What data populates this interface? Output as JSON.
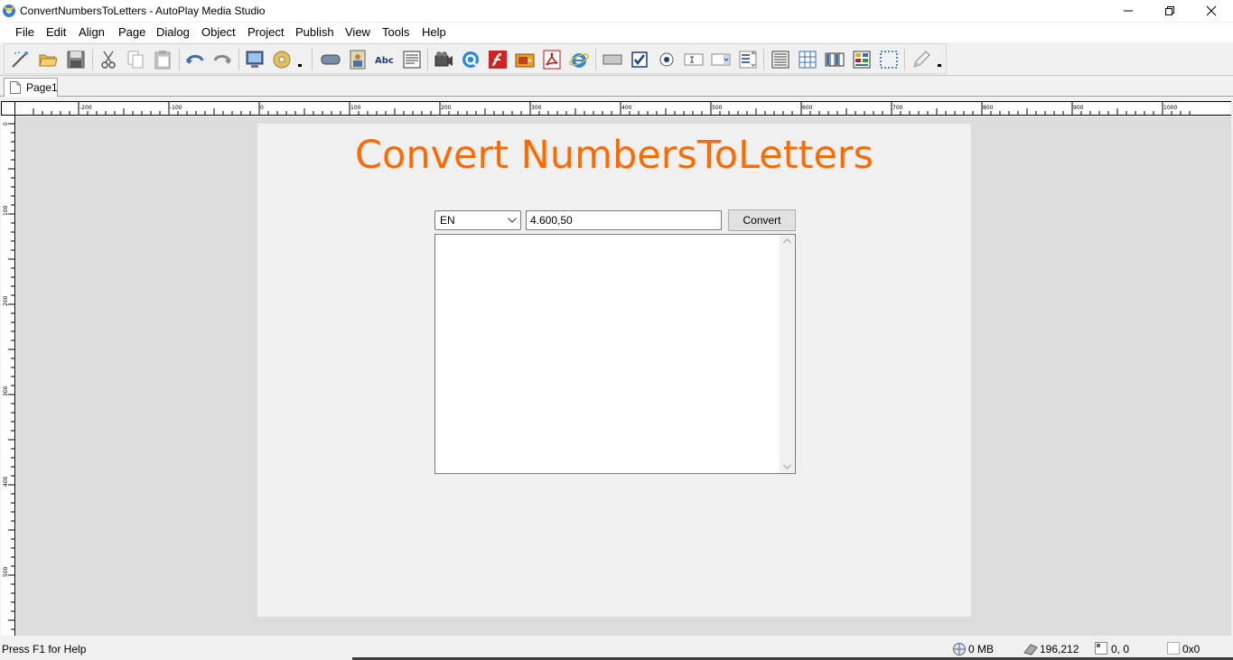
{
  "window": {
    "title": "ConvertNumbersToLetters - AutoPlay Media Studio"
  },
  "menu": {
    "items": [
      "File",
      "Edit",
      "Align",
      "Page",
      "Dialog",
      "Object",
      "Project",
      "Publish",
      "View",
      "Tools",
      "Help"
    ]
  },
  "toolbar": {
    "icons": [
      "new-project-wizard-icon",
      "open-icon",
      "save-icon",
      "cut-icon",
      "copy-icon",
      "paste-icon",
      "undo-icon",
      "redo-icon",
      "preview-icon",
      "publish-cd-icon",
      "button-object-icon",
      "image-object-icon",
      "label-object-icon",
      "paragraph-object-icon",
      "video-object-icon",
      "quicktime-object-icon",
      "flash-object-icon",
      "slideshow-object-icon",
      "pdf-object-icon",
      "web-object-icon",
      "input-object-icon",
      "checkbox-object-icon",
      "radiobutton-object-icon",
      "input-field-object-icon",
      "combobox-object-icon",
      "listbox-object-icon",
      "grid-object-icon",
      "table-grid-object-icon",
      "tree-object-icon",
      "progress-object-icon",
      "selection-object-icon",
      "plugin-object-icon"
    ]
  },
  "tabs": {
    "page1": "Page1"
  },
  "ruler": {
    "horizontal": [
      "-200",
      "-100",
      "0",
      "100",
      "200",
      "300",
      "400",
      "500",
      "600",
      "700",
      "800",
      "900",
      "1000"
    ],
    "vertical": [
      "0",
      "100",
      "200",
      "300",
      "400",
      "500"
    ]
  },
  "page": {
    "heading": "Convert NumbersToLetters",
    "heading_color": "#ff6a00",
    "language_value": "EN",
    "number_value": "4.600,50",
    "convert_label": "Convert",
    "output_text": ""
  },
  "status": {
    "help": "Press F1 for Help",
    "memory": "0 MB",
    "cursor": "196,212",
    "position": "0, 0",
    "size": "0x0"
  }
}
